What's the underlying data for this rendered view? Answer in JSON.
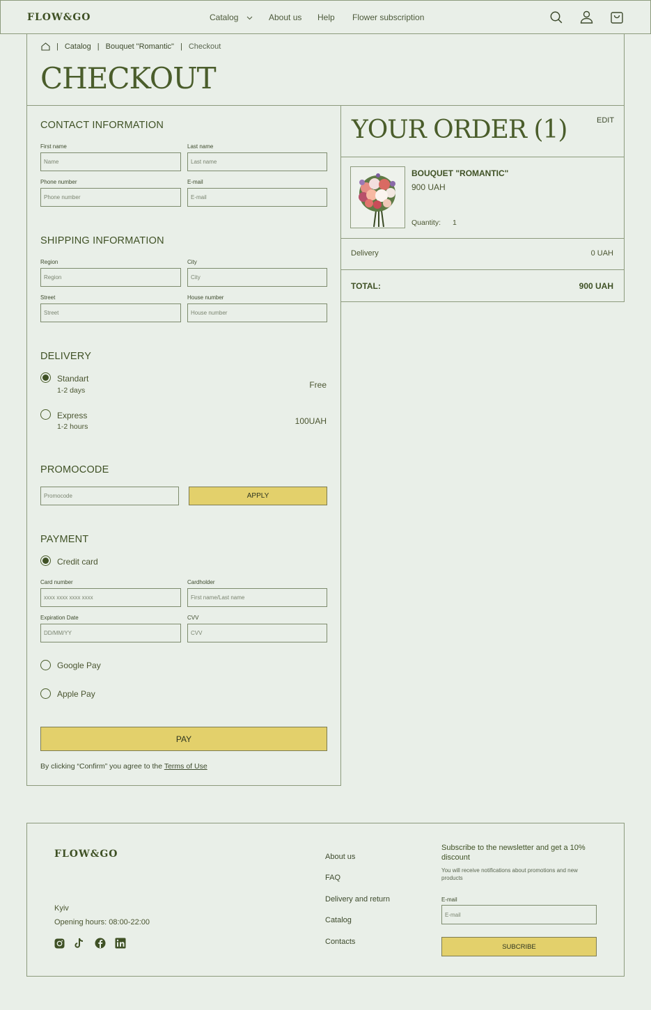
{
  "header": {
    "logo": "FLOW&GO",
    "nav": [
      "Catalog",
      "About us",
      "Help",
      "Flower subscription"
    ],
    "icons": [
      "search-icon",
      "user-icon",
      "bag-icon"
    ]
  },
  "breadcrumb": {
    "items": [
      "Catalog",
      "Bouquet \"Romantic\"",
      "Checkout"
    ],
    "home_icon": "home-icon"
  },
  "page_title": "CHECKOUT",
  "contact": {
    "title": "CONTACT INFORMATION",
    "first_name": {
      "label": "First name",
      "placeholder": "Name"
    },
    "last_name": {
      "label": "Last name",
      "placeholder": "Last name"
    },
    "phone": {
      "label": "Phone number",
      "placeholder": "Phone number"
    },
    "email": {
      "label": "E-mail",
      "placeholder": "E-mail"
    }
  },
  "shipping": {
    "title": "SHIPPING INFORMATION",
    "region": {
      "label": "Region",
      "placeholder": "Region"
    },
    "city": {
      "label": "City",
      "placeholder": "City"
    },
    "street": {
      "label": "Street",
      "placeholder": "Street"
    },
    "house": {
      "label": "House number",
      "placeholder": "House number"
    }
  },
  "delivery": {
    "title": "DELIVERY",
    "options": [
      {
        "label": "Standart",
        "sub": "1-2 days",
        "price": "Free",
        "selected": true
      },
      {
        "label": "Express",
        "sub": "1-2 hours",
        "price": "100UAH",
        "selected": false
      }
    ]
  },
  "promo": {
    "title": "PROMOCODE",
    "placeholder": "Promocode",
    "button": "APPLY"
  },
  "payment": {
    "title": "PAYMENT",
    "credit_card": "Credit card",
    "card_number": {
      "label": "Card number",
      "placeholder": "xxxx xxxx xxxx xxxx"
    },
    "cardholder": {
      "label": "Cardholder",
      "placeholder": "First name/Last name"
    },
    "expiration": {
      "label": "Expiration Date",
      "placeholder": "DD/MM/YY"
    },
    "cvv": {
      "label": "CVV",
      "placeholder": "CVV"
    },
    "google_pay": "Google Pay",
    "apple_pay": "Apple Pay",
    "pay_button": "PAY",
    "terms_prefix": "By clicking “Confirm”  you agree to the",
    "terms_link": "Terms of Use"
  },
  "order": {
    "title": "YOUR ORDER (1)",
    "edit": "EDIT",
    "item": {
      "name": "BOUQUET \"ROMANTIC\"",
      "price": "900 UAH",
      "quantity_label": "Quantity:",
      "quantity": "1"
    },
    "delivery_label": "Delivery",
    "delivery_value": "0 UAH",
    "total_label": "TOTAL:",
    "total_value": "900 UAH"
  },
  "footer": {
    "logo": "FLOW&GO",
    "city": "Kyiv",
    "hours": "Opening hours: 08:00-22:00",
    "social": [
      "instagram-icon",
      "tiktok-icon",
      "facebook-icon",
      "linkedin-icon"
    ],
    "links": [
      "About us",
      "FAQ",
      "Delivery and return",
      "Catalog",
      "Contacts"
    ],
    "newsletter_title": "Subscribe to the newsletter and get a 10% discount",
    "newsletter_text": "You will receive notifications about promotions and new products",
    "email_label": "E-mail",
    "email_placeholder": "E-mail",
    "subscribe_button": "SUBCRIBE"
  },
  "colors": {
    "background": "#e9efe8",
    "accent_green": "#4a5d2b",
    "button_yellow": "#e3d06b",
    "border": "#8c9a7c"
  }
}
